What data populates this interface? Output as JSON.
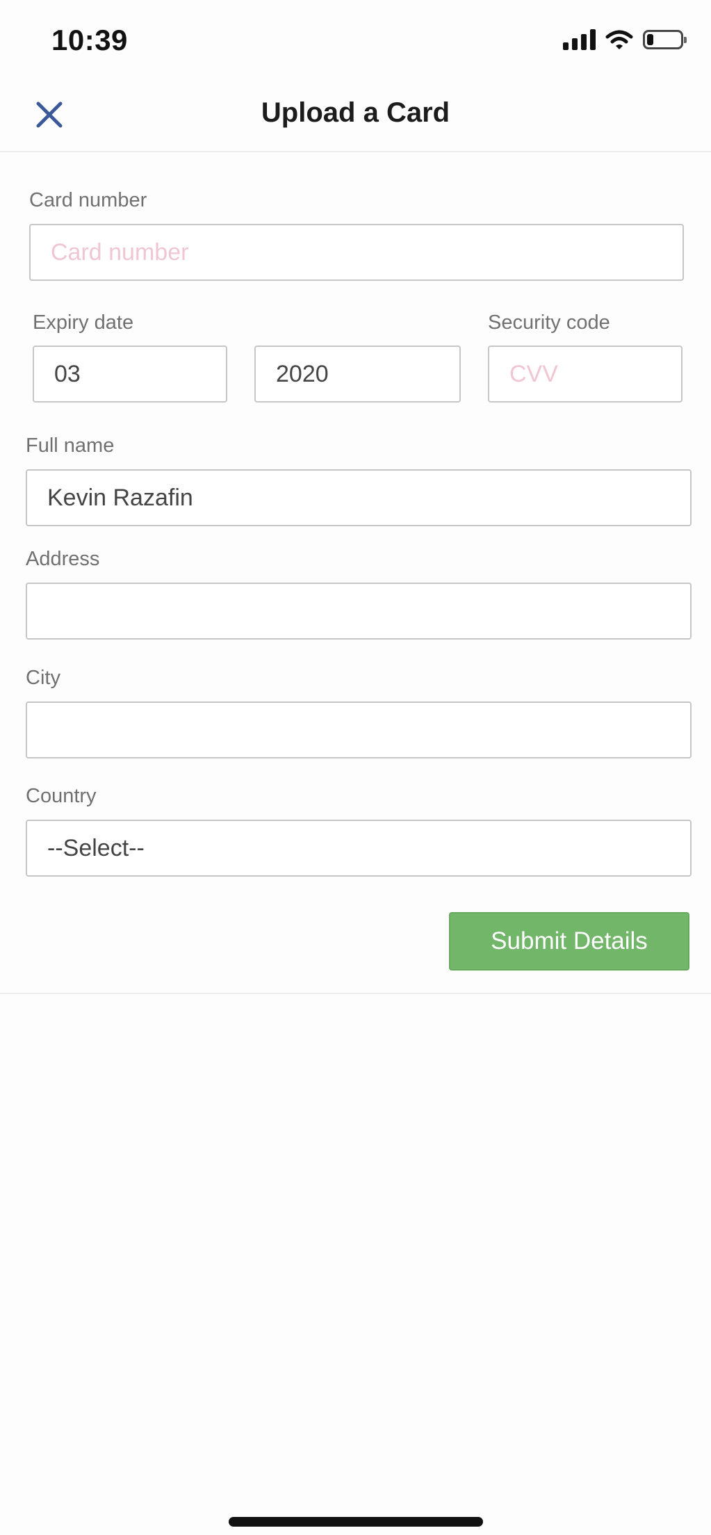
{
  "status_bar": {
    "time": "10:39",
    "battery_icon": "battery-low-icon",
    "wifi_icon": "wifi-icon",
    "signal_icon": "cellular-signal-icon"
  },
  "header": {
    "title": "Upload a Card",
    "close_icon": "close-icon",
    "accent_color": "#3b5998"
  },
  "form": {
    "card_number": {
      "label": "Card number",
      "placeholder": "Card number",
      "value": ""
    },
    "expiry": {
      "label": "Expiry date",
      "month": "03",
      "year": "2020"
    },
    "security_code": {
      "label": "Security code",
      "placeholder": "CVV",
      "value": ""
    },
    "full_name": {
      "label": "Full name",
      "value": "Kevin Razafin"
    },
    "address": {
      "label": "Address",
      "value": ""
    },
    "city": {
      "label": "City",
      "value": ""
    },
    "country": {
      "label": "Country",
      "selected": "--Select--"
    },
    "submit_label": "Submit Details",
    "submit_color": "#72b66a"
  }
}
